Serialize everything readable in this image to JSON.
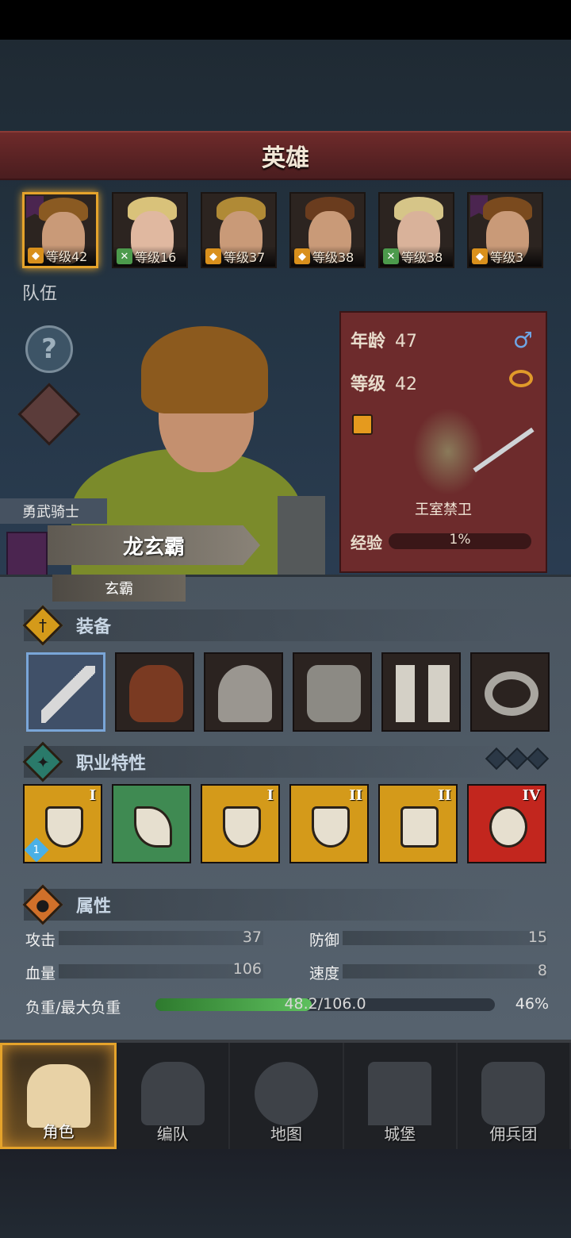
{
  "title": "英雄",
  "heroes": [
    {
      "level": "等级42",
      "class_icon": "shield-icon",
      "selected": true
    },
    {
      "level": "等级16",
      "class_icon": "bow-icon",
      "selected": false
    },
    {
      "level": "等级37",
      "class_icon": "shield-icon",
      "selected": false
    },
    {
      "level": "等级38",
      "class_icon": "shield-icon",
      "selected": false
    },
    {
      "level": "等级38",
      "class_icon": "bow-icon",
      "selected": false
    },
    {
      "level": "等级3",
      "class_icon": "shield-icon",
      "selected": false
    }
  ],
  "team_label": "队伍",
  "help_icon_text": "?",
  "info": {
    "age_label": "年龄",
    "age": "47",
    "level_label": "等级",
    "level": "42",
    "gender_symbol": "♂",
    "unit_name": "王室禁卫",
    "exp_label": "经验",
    "exp_value": "1%",
    "exp_fraction": 0.01
  },
  "hero": {
    "class_title": "勇武骑士",
    "name": "龙玄霸",
    "nickname": "玄霸"
  },
  "sections": {
    "equipment": "装备",
    "traits": "职业特性",
    "attributes": "属性"
  },
  "equipment": [
    {
      "name": "sword-icon",
      "color": "#d8d8d8"
    },
    {
      "name": "branch-shield-icon",
      "color": "#7a3a22"
    },
    {
      "name": "helmet-icon",
      "color": "#9a9690"
    },
    {
      "name": "chainmail-armor-icon",
      "color": "#8c8a84"
    },
    {
      "name": "greaves-icon",
      "color": "#d4d0c6"
    },
    {
      "name": "ring-icon",
      "color": "#a9a6a0"
    }
  ],
  "traits": [
    {
      "rank": "I",
      "bg": "#d49a1a",
      "tier": "1",
      "name": "sword-shield-trait-icon"
    },
    {
      "rank": "",
      "bg": "#3f8a52",
      "tier": "",
      "name": "charge-trait-icon"
    },
    {
      "rank": "I",
      "bg": "#d49a1a",
      "tier": "",
      "name": "shield-arrow-trait-icon"
    },
    {
      "rank": "II",
      "bg": "#d49a1a",
      "tier": "",
      "name": "shield-trait-icon"
    },
    {
      "rank": "II",
      "bg": "#d49a1a",
      "tier": "",
      "name": "shield-break-trait-icon"
    },
    {
      "rank": "IV",
      "bg": "#c2261e",
      "tier": "",
      "name": "heartbeat-trait-icon"
    }
  ],
  "stats": {
    "attack_label": "攻击",
    "attack": "37",
    "defense_label": "防御",
    "defense": "15",
    "hp_label": "血量",
    "hp": "106",
    "speed_label": "速度",
    "speed": "8",
    "load_label": "负重/最大负重",
    "load": "48.2/106.0",
    "load_pct": "46%",
    "load_fraction": 0.46
  },
  "nav": [
    {
      "label": "角色",
      "icon": "knight-icon",
      "selected": true
    },
    {
      "label": "编队",
      "icon": "helmet-group-icon",
      "selected": false
    },
    {
      "label": "地图",
      "icon": "compass-icon",
      "selected": false
    },
    {
      "label": "城堡",
      "icon": "castle-icon",
      "selected": false
    },
    {
      "label": "佣兵团",
      "icon": "mercenary-icon",
      "selected": false
    }
  ]
}
